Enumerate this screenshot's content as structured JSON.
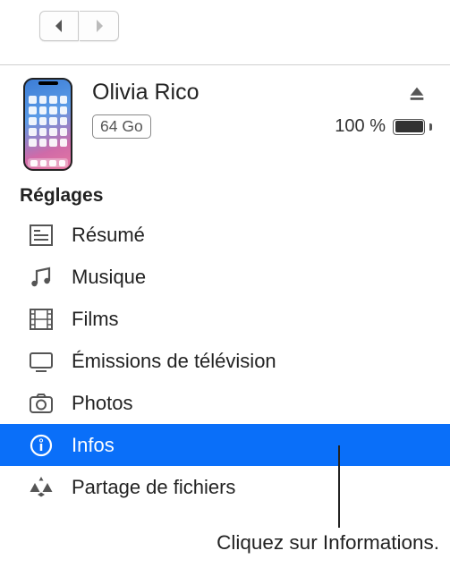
{
  "header": {
    "device_name": "Olivia Rico",
    "capacity": "64 Go",
    "battery_percent": "100 %"
  },
  "section_title": "Réglages",
  "settings": [
    {
      "id": "summary",
      "label": "Résumé",
      "icon": "summary-icon",
      "selected": false
    },
    {
      "id": "music",
      "label": "Musique",
      "icon": "music-icon",
      "selected": false
    },
    {
      "id": "films",
      "label": "Films",
      "icon": "films-icon",
      "selected": false
    },
    {
      "id": "tv",
      "label": "Émissions de télévision",
      "icon": "tv-icon",
      "selected": false
    },
    {
      "id": "photos",
      "label": "Photos",
      "icon": "photos-icon",
      "selected": false
    },
    {
      "id": "info",
      "label": "Infos",
      "icon": "info-icon",
      "selected": true
    },
    {
      "id": "filesharing",
      "label": "Partage de fichiers",
      "icon": "apps-icon",
      "selected": false
    }
  ],
  "callout": "Cliquez sur Informations."
}
